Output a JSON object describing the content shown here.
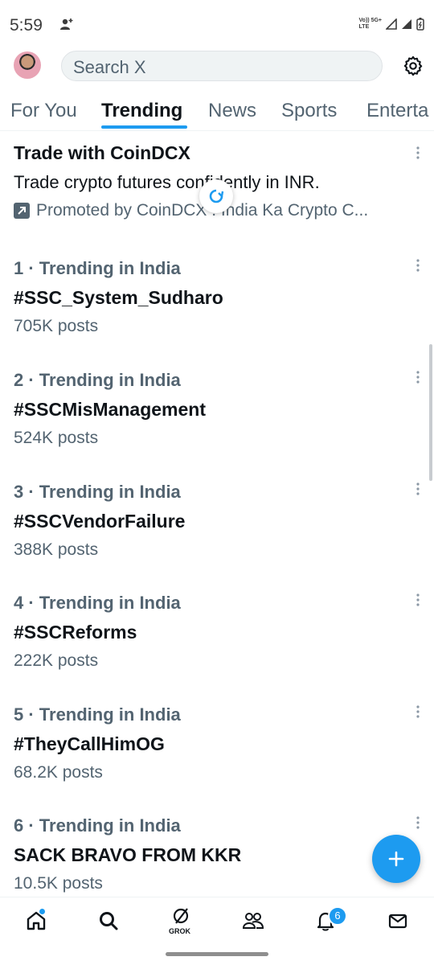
{
  "status_bar": {
    "time": "5:59",
    "network_top": "Vo)) 5G+",
    "network_bottom": "LTE"
  },
  "header": {
    "search_placeholder": "Search X"
  },
  "tabs": [
    {
      "label": "For You"
    },
    {
      "label": "Trending",
      "active": true
    },
    {
      "label": "News"
    },
    {
      "label": "Sports"
    },
    {
      "label": "Enterta"
    }
  ],
  "promo": {
    "title": "Trade with CoinDCX",
    "description": "Trade crypto futures confidently in INR.",
    "promoted_by": "Promoted by CoinDCX : India Ka Crypto C..."
  },
  "trends": [
    {
      "meta": "1 · Trending in India",
      "name": "#SSC_System_Sudharo",
      "count": "705K posts"
    },
    {
      "meta": "2 · Trending in India",
      "name": "#SSCMisManagement",
      "count": "524K posts"
    },
    {
      "meta": "3 · Trending in India",
      "name": "#SSCVendorFailure",
      "count": "388K posts"
    },
    {
      "meta": "4 · Trending in India",
      "name": "#SSCReforms",
      "count": "222K posts"
    },
    {
      "meta": "5 · Trending in India",
      "name": "#TheyCallHimOG",
      "count": "68.2K posts"
    },
    {
      "meta": "6 · Trending in India",
      "name": "SACK BRAVO FROM KKR",
      "count": "10.5K posts"
    }
  ],
  "bottom_nav": {
    "grok_label": "GROK",
    "notifications_badge": "6"
  },
  "colors": {
    "accent": "#1d9bf0",
    "text_primary": "#0f1419",
    "text_secondary": "#536471"
  }
}
